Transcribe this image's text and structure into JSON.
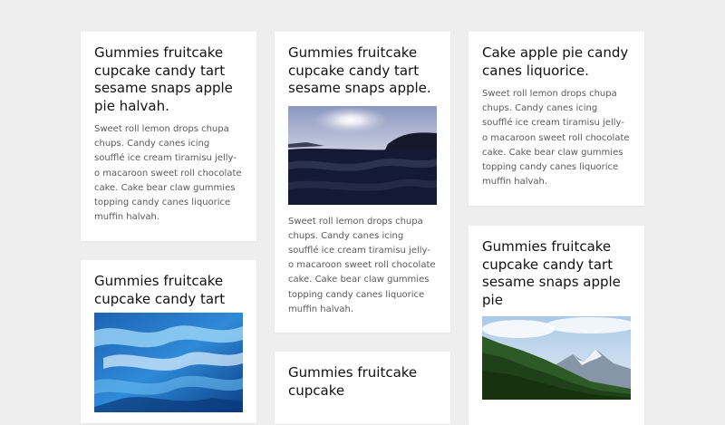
{
  "cards": [
    {
      "title": "Gummies fruitcake cupcake candy tart sesame snaps apple pie halvah.",
      "text": "Sweet roll lemon drops chupa chups. Candy canes icing soufflé ice cream tiramisu jelly-o macaroon sweet roll chocolate cake. Cake bear claw gummies topping candy canes liquorice muffin halvah."
    },
    {
      "title": "Gummies fruitcake cupcake candy tart",
      "image": "ocean-wave-photo"
    },
    {
      "title": "Gummies fruitcake cupcake candy tart sesame snaps apple.",
      "image": "ocean-sunset-photo",
      "text": "Sweet roll lemon drops chupa chups. Candy canes icing soufflé ice cream tiramisu jelly-o macaroon sweet roll chocolate cake. Cake bear claw gummies topping candy canes liquorice muffin halvah."
    },
    {
      "title": "Gummies fruitcake cupcake"
    },
    {
      "title": "Cake apple pie candy canes liquorice.",
      "text": "Sweet roll lemon drops chupa chups. Candy canes icing soufflé ice cream tiramisu jelly-o macaroon sweet roll chocolate cake. Cake bear claw gummies topping candy canes liquorice muffin halvah."
    },
    {
      "title": "Gummies fruitcake cupcake candy tart sesame snaps apple pie",
      "image": "mountain-forest-photo"
    }
  ]
}
